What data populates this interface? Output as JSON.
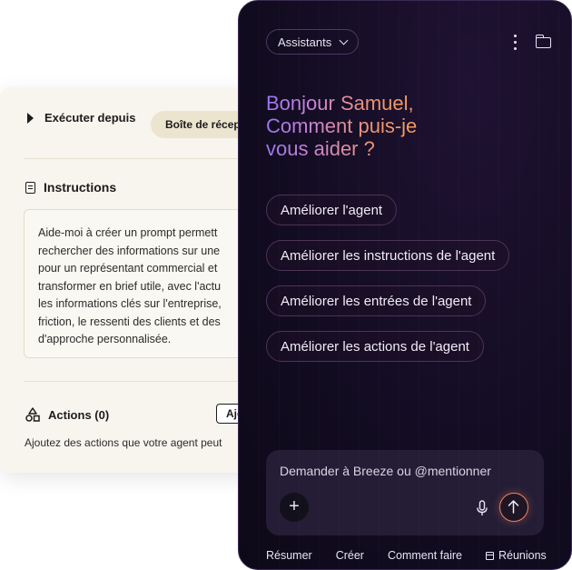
{
  "back_card": {
    "run_label": "Exécuter depuis",
    "inbox_pill": "Boîte de récep",
    "instructions_title": "Instructions",
    "instructions_lines": [
      "Aide-moi à créer un prompt permett",
      "rechercher des informations sur une",
      "pour un représentant commercial et",
      "transformer en brief utile, avec l'actu",
      "les informations clés sur l'entreprise,",
      "friction, le ressenti des clients et des",
      "d'approche personnalisée."
    ],
    "actions_title": "Actions (0)",
    "add_button": "Ajouter",
    "actions_desc": "Ajoutez des actions que votre agent peut"
  },
  "panel": {
    "assistant_button": "Assistants",
    "greeting": [
      "Bonjour Samuel,",
      "Comment puis-je",
      "vous aider ?"
    ],
    "suggestions": [
      "Améliorer l'agent",
      "Améliorer les instructions de l'agent",
      "Améliorer les entrées de l'agent",
      "Améliorer les actions de l'agent"
    ],
    "composer_placeholder": "Demander à Breeze ou @mentionner",
    "plus_symbol": "+",
    "footer": {
      "summarize": "Résumer",
      "create": "Créer",
      "howto": "Comment faire",
      "meetings": "Réunions"
    }
  },
  "colors": {
    "panel_bg": "#130c22",
    "accent_orange": "#f0815a",
    "accent_purple": "#9a74f0",
    "back_card_bg": "#f8f5ee"
  }
}
